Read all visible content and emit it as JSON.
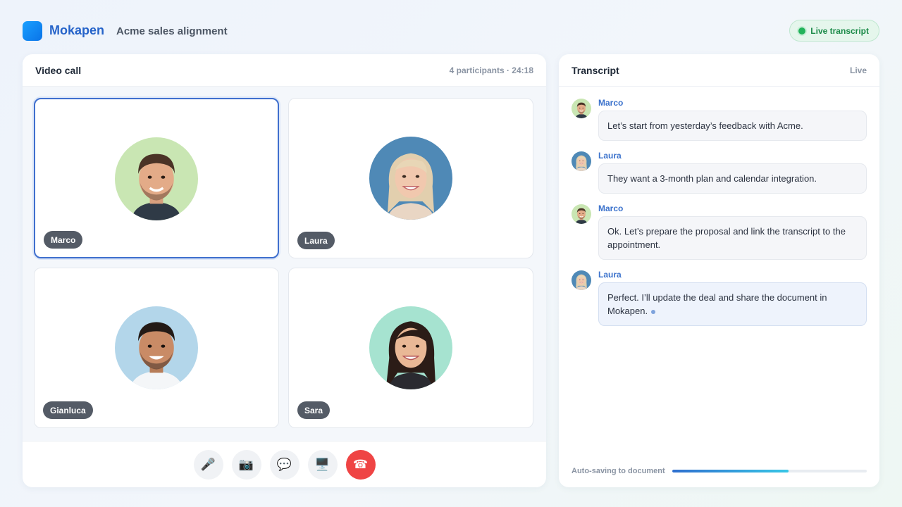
{
  "app": {
    "brand": "Mokapen",
    "meeting_title": "Acme sales alignment",
    "live_badge": "Live transcript",
    "colors": {
      "accent": "#2563c9",
      "live": "#22b35a",
      "end_call": "#ef4444"
    }
  },
  "video": {
    "title": "Video call",
    "meta": "4 participants · 24:18",
    "participants": [
      {
        "name": "Marco",
        "active": true
      },
      {
        "name": "Laura",
        "active": false
      },
      {
        "name": "Gianluca",
        "active": false
      },
      {
        "name": "Sara",
        "active": false
      }
    ],
    "controls": [
      {
        "icon": "microphone-icon",
        "glyph": "🎤"
      },
      {
        "icon": "camera-icon",
        "glyph": "📷"
      },
      {
        "icon": "chat-icon",
        "glyph": "💬"
      },
      {
        "icon": "screen-share-icon",
        "glyph": "🖥️"
      },
      {
        "icon": "end-call-icon",
        "glyph": "☎"
      }
    ]
  },
  "transcript": {
    "title": "Transcript",
    "status": "Live",
    "messages": [
      {
        "speaker": "Marco",
        "text": "Let’s start from yesterday’s feedback with Acme."
      },
      {
        "speaker": "Laura",
        "text": "They want a 3-month plan and calendar integration."
      },
      {
        "speaker": "Marco",
        "text": "Ok. Let’s prepare the proposal and link the transcript to the appointment."
      },
      {
        "speaker": "Laura",
        "text": "Perfect. I’ll update the deal and share the document in Mokapen."
      }
    ],
    "autosave_label": "Auto-saving to document",
    "autosave_progress": 0.6
  }
}
